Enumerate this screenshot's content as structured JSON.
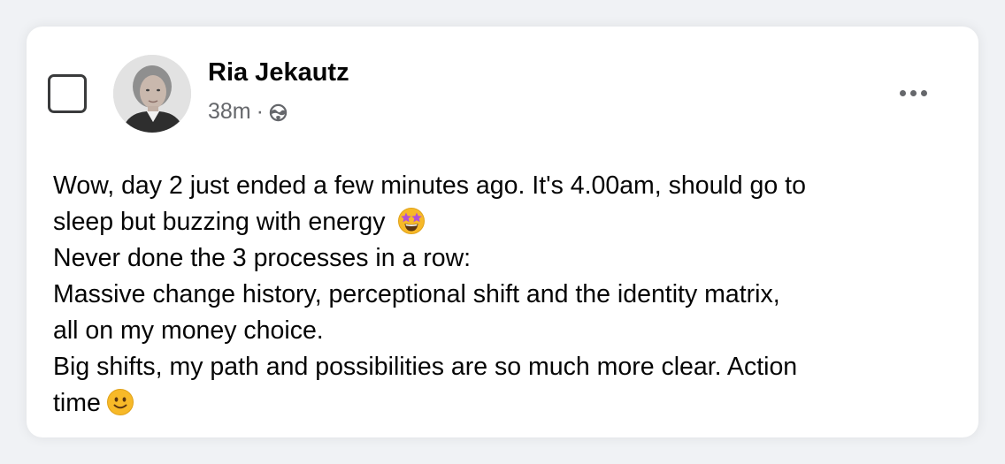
{
  "post": {
    "author": "Ria Jekautz",
    "time": "38m",
    "separator": "·",
    "audience_icon": "globe-icon",
    "more_icon": "more-options-icon",
    "emoji_1": "star-struck-emoji",
    "emoji_2": "slightly-smiling-emoji",
    "lines": [
      "Wow, day 2 just ended a few minutes ago. It's 4.00am, should go to",
      "sleep but buzzing with energy ",
      "Never done the 3 processes in a row:",
      "Massive change history, perceptional shift and the identity matrix,",
      "all on my money choice.",
      "Big shifts, my path and possibilities are so much more clear. Action",
      "time"
    ]
  },
  "colors": {
    "background": "#f0f2f5",
    "card": "#ffffff",
    "text_primary": "#050505",
    "text_secondary": "#65676b",
    "emoji_yellow": "#f7b928"
  }
}
